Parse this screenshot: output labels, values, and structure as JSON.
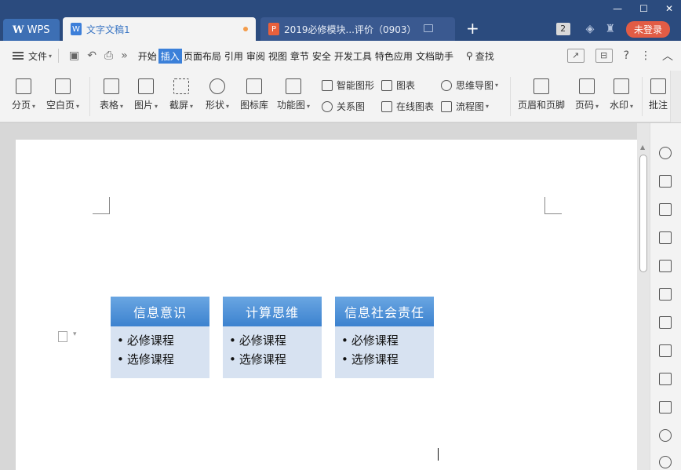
{
  "titlebar": {
    "wps_tab": "WPS",
    "doc_tab": "文字文稿1",
    "ppt_tab": "2019必修模块...评价（0903）",
    "tab_count": "2",
    "login_label": "未登录"
  },
  "menubar": {
    "file_label": "文件",
    "items": [
      "开始",
      "插入",
      "页面布局",
      "引用",
      "审阅",
      "视图",
      "章节",
      "安全",
      "开发工具",
      "特色应用",
      "文档助手"
    ],
    "active_item": "插入",
    "search_label": "查找"
  },
  "ribbon": {
    "page_break": "分页",
    "blank_page": "空白页",
    "table": "表格",
    "picture": "图片",
    "screenshot": "截屏",
    "shape": "形状",
    "icon_lib": "图标库",
    "func_chart": "功能图",
    "smart_graphic": "智能图形",
    "chart": "图表",
    "mind_map": "思维导图",
    "relation_chart": "关系图",
    "online_chart": "在线图表",
    "flow_chart": "流程图",
    "header_footer": "页眉和页脚",
    "page_number": "页码",
    "watermark": "水印",
    "comment": "批注"
  },
  "document": {
    "columns": [
      {
        "title": "信息意识",
        "items": [
          "必修课程",
          "选修课程"
        ]
      },
      {
        "title": "计算思维",
        "items": [
          "必修课程",
          "选修课程"
        ]
      },
      {
        "title": "信息社会责任",
        "items": [
          "必修课程",
          "选修课程"
        ]
      }
    ]
  },
  "colors": {
    "titlebar_bg": "#2b4b7e",
    "accent_blue": "#3b80d9",
    "smartart_head": "#4a8fd8",
    "smartart_body": "#d7e2f1",
    "login_red": "#e25c45"
  }
}
